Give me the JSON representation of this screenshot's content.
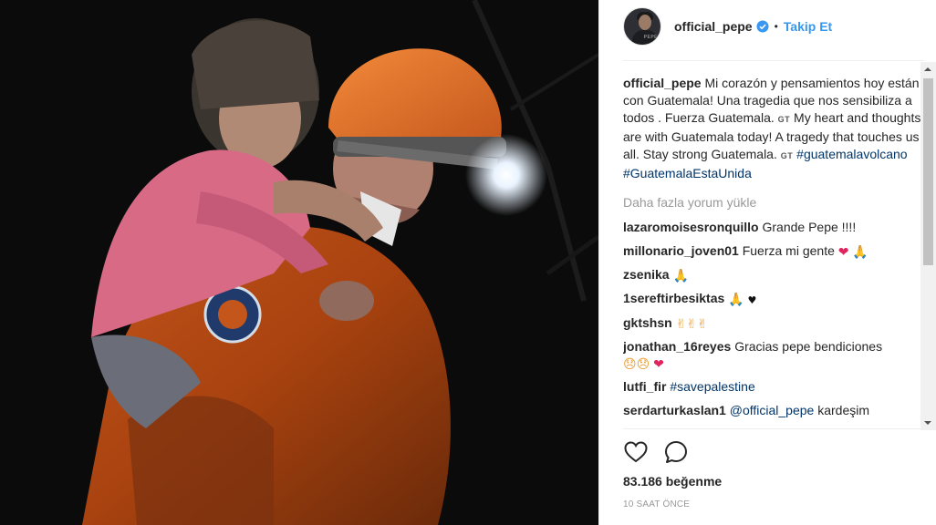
{
  "post": {
    "username": "official_pepe",
    "follow_label": "Takip Et",
    "dot": "•",
    "avatar_text": "PEPE"
  },
  "caption": {
    "username": "official_pepe",
    "text_es": "Mi corazón y pensamientos hoy están con Guatemala! Una tragedia que nos sensibiliza a todos . Fuerza Guatemala.",
    "flag1": "GT",
    "text_en": "My heart and thoughts are with Guatemala today! A tragedy that touches us all. Stay strong Guatemala.",
    "flag2": "GT",
    "hashtag1": "#guatemalavolcano",
    "hashtag2": "#GuatemalaEstaUnida"
  },
  "load_more": "Daha fazla yorum yükle",
  "comments": [
    {
      "user": "lazaromoisesronquillo",
      "text": "Grande Pepe !!!!"
    },
    {
      "user": "millonario_joven01",
      "text": "Fuerza mi gente",
      "emoji": "❤",
      "emoji2": "🙏"
    },
    {
      "user": "zsenika",
      "text": "",
      "emoji": "🙏"
    },
    {
      "user": "1sereftirbesiktas",
      "text": "",
      "emoji": "🙏",
      "emoji2": "♥"
    },
    {
      "user": "gktshsn",
      "text": "",
      "emoji": "✌✌✌"
    },
    {
      "user": "jonathan_16reyes",
      "text": "Gracias pepe bendiciones",
      "emoji": "😞😞",
      "emoji2": "❤"
    },
    {
      "user": "lutfi_fir",
      "text": "#savepalestine"
    },
    {
      "user": "serdarturkaslan1",
      "text": "@official_pepe",
      "text2": "kardeşim"
    }
  ],
  "likes": "83.186 beğenme",
  "time": "10 SAAT ÖNCE",
  "icons": {
    "verified": "verified-badge-icon",
    "like": "heart-outline-icon",
    "comment": "comment-bubble-icon"
  },
  "colors": {
    "link": "#3897f0",
    "hashtag": "#003569",
    "muted": "#999999",
    "text": "#262626"
  }
}
